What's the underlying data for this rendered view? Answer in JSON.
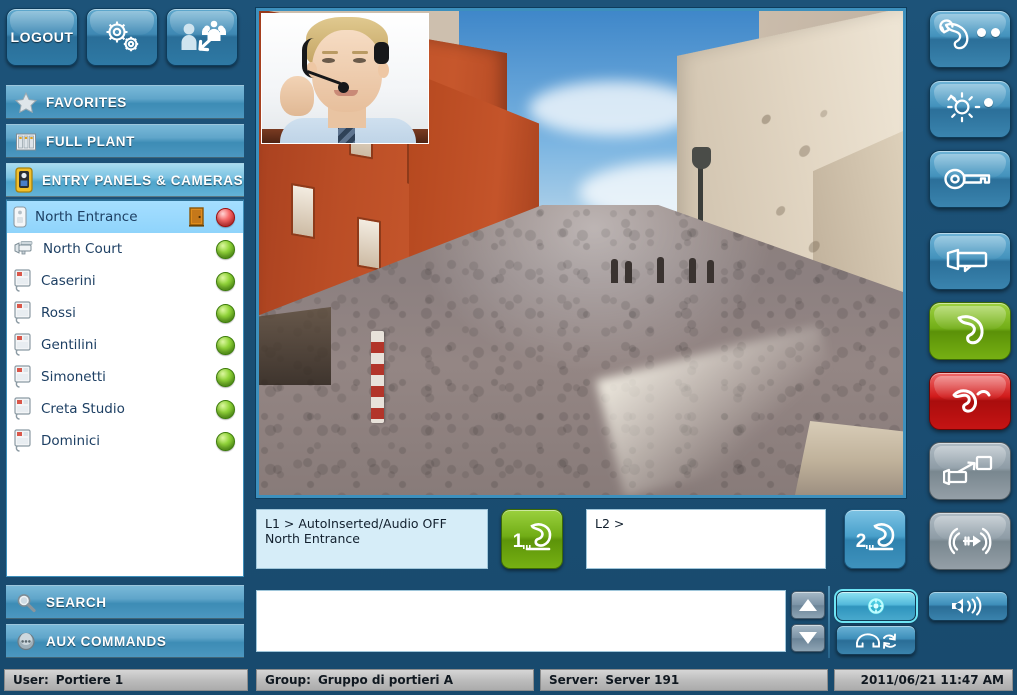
{
  "toolbar": {
    "logout_label": "LOGOUT",
    "settings_icon": "gears-icon",
    "switch_user_icon": "user-switch-icon"
  },
  "sidebar": {
    "sections": [
      {
        "id": "favorites",
        "label": "FAVORITES",
        "icon": "star-icon",
        "active": false
      },
      {
        "id": "full-plant",
        "label": "FULL PLANT",
        "icon": "building-icon",
        "active": false
      },
      {
        "id": "entry-panels",
        "label": "ENTRY PANELS & CAMERAS",
        "icon": "entry-panel-icon",
        "active": true
      }
    ],
    "bottom_sections": [
      {
        "id": "search",
        "label": "SEARCH",
        "icon": "magnifier-icon"
      },
      {
        "id": "aux-commands",
        "label": "AUX COMMANDS",
        "icon": "aux-command-icon"
      }
    ],
    "list": [
      {
        "name": "North Entrance",
        "icon": "entry-panel-icon",
        "door": true,
        "led": "red",
        "selected": true
      },
      {
        "name": "North Court",
        "icon": "camera-icon",
        "door": false,
        "led": "green",
        "selected": false
      },
      {
        "name": "Caserini",
        "icon": "intercom-icon",
        "door": false,
        "led": "green",
        "selected": false
      },
      {
        "name": "Rossi",
        "icon": "intercom-icon",
        "door": false,
        "led": "green",
        "selected": false
      },
      {
        "name": "Gentilini",
        "icon": "intercom-icon",
        "door": false,
        "led": "green",
        "selected": false
      },
      {
        "name": "Simonetti",
        "icon": "intercom-icon",
        "door": false,
        "led": "green",
        "selected": false
      },
      {
        "name": "Creta Studio",
        "icon": "intercom-icon",
        "door": false,
        "led": "green",
        "selected": false
      },
      {
        "name": "Dominici",
        "icon": "intercom-icon",
        "door": false,
        "led": "green",
        "selected": false
      }
    ]
  },
  "video": {
    "scene_description": "Live camera view of a narrow cobblestone street between a red building and a beige stone building",
    "pip_description": "Operator with headset"
  },
  "lines": {
    "line1": {
      "status_text": "L1 > AutoInserted/Audio OFF",
      "device_text": "North Entrance",
      "button_number": "1",
      "button_state": "active"
    },
    "line2": {
      "status_text": "L2 >",
      "device_text": "",
      "button_number": "2",
      "button_state": "idle"
    }
  },
  "messages": {
    "items": [],
    "scroll_up_icon": "triangle-up-icon",
    "scroll_down_icon": "triangle-down-icon"
  },
  "bottom_buttons": [
    {
      "id": "open-door",
      "icon": "door-release-icon",
      "selected": true
    },
    {
      "id": "call-back",
      "icon": "callback-icon",
      "selected": false
    },
    {
      "id": "volume",
      "icon": "speaker-icon",
      "selected": false
    }
  ],
  "right_buttons": [
    {
      "id": "call-transfer",
      "icon": "call-transfer-icon",
      "style": "blue",
      "badges": 2
    },
    {
      "id": "light-control",
      "icon": "light-icon",
      "style": "blue",
      "badges": 1
    },
    {
      "id": "door-key",
      "icon": "key-icon",
      "style": "blue",
      "badges": 0
    },
    {
      "id": "camera-cycle",
      "icon": "camera-icon",
      "style": "blue",
      "badges": 0
    },
    {
      "id": "answer-call",
      "icon": "handset-up-icon",
      "style": "green",
      "badges": 0
    },
    {
      "id": "hangup-call",
      "icon": "handset-down-icon",
      "style": "red",
      "badges": 0
    },
    {
      "id": "camera-expand",
      "icon": "camera-expand-icon",
      "style": "grey",
      "badges": 0
    },
    {
      "id": "call-forward",
      "icon": "call-forward-icon",
      "style": "grey",
      "badges": 0
    }
  ],
  "statusbar": {
    "user_key": "User:",
    "user_value": "Portiere 1",
    "group_key": "Group:",
    "group_value": "Gruppo di portieri A",
    "server_key": "Server:",
    "server_value": "Server 191",
    "datetime": "2011/06/21  11:47 AM"
  },
  "colors": {
    "background": "#1a4d72",
    "panel_blue": "#3d8cb5",
    "active_section": "#7cc3e2",
    "selected_row": "#8fd4fb",
    "led_green": "#93d63b",
    "led_red": "#f86a6a",
    "answer_green": "#72ae17",
    "hangup_red": "#d11b1b",
    "statusbar_grey": "#bdbdbd"
  }
}
